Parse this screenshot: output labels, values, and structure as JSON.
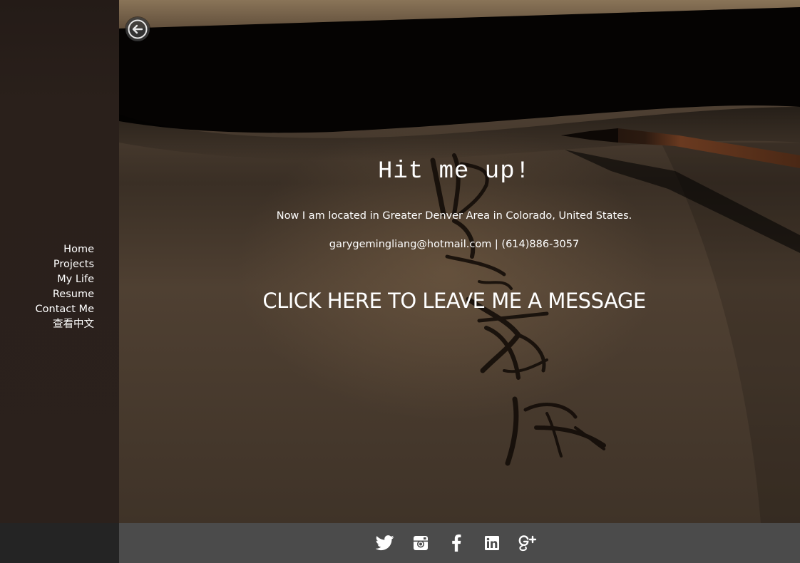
{
  "sidebar": {
    "nav": [
      {
        "label": "Home"
      },
      {
        "label": "Projects"
      },
      {
        "label": "My Life"
      },
      {
        "label": "Resume"
      },
      {
        "label": "Contact Me"
      },
      {
        "label": "查看中文"
      }
    ]
  },
  "main": {
    "title": "Hit me up!",
    "location": "Now I am located in Greater Denver Area in Colorado, United States.",
    "contact": "garygemingliang@hotmail.com | (614)886-3057",
    "cta": "CLICK HERE TO LEAVE ME A MESSAGE"
  },
  "footer": {
    "social_icons": [
      "twitter-icon",
      "instagram-icon",
      "facebook-icon",
      "linkedin-icon",
      "google-plus-icon"
    ]
  },
  "colors": {
    "sidebar_bg": "#2b211c",
    "footer_bg": "#4b4b4b",
    "footer_left_bg": "#242424",
    "text": "#ffffff"
  },
  "icons": {
    "back": "arrow-left-circle-icon"
  }
}
